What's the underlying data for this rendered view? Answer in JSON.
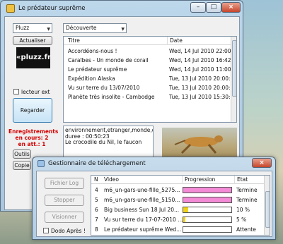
{
  "main": {
    "title": "Le prédateur suprême",
    "source_combo": "Pluzz",
    "category_combo": "Découverte",
    "refresh_label": "Actualiser",
    "logo_text": "«pluzz.fr",
    "ext_player_label": "lecteur ext",
    "watch_label": "Regarder",
    "recording_status": "Enregistrements",
    "recording_current": "en cours: 2",
    "recording_pending": "en att.: 1",
    "tools_label": "Outils",
    "copy_label": "Copie",
    "columns": [
      "Titre",
      "Date"
    ],
    "rows": [
      {
        "title": "Accordéons-nous !",
        "date": "Wed, 14 Jul 2010 22:00:..."
      },
      {
        "title": "Caraïbes - Un monde de corail",
        "date": "Wed, 14 Jul 2010 16:42:..."
      },
      {
        "title": "Le prédateur suprême",
        "date": "Wed, 14 Jul 2010 11:00:..."
      },
      {
        "title": "Expédition Alaska",
        "date": "Tue, 13 Jul 2010 20:00:..."
      },
      {
        "title": "Vu sur terre du 13/07/2010",
        "date": "Tue, 13 Jul 2010 20:00:..."
      },
      {
        "title": "Planète très insolite - Cambodge",
        "date": "Tue, 13 Jul 2010 15:30:..."
      }
    ],
    "info_tags": "environnement,etranger,monde,documentaire",
    "info_duration": "duree : 00:50:23",
    "info_text": "Le crocodile du Nil, le faucon"
  },
  "dm": {
    "title": "Gestionnaire de téléchargement",
    "file_log_label": "Fichier Log",
    "stop_label": "Stopper",
    "view_label": "Visionner",
    "shutdown_label": "Dodo Après !",
    "columns": [
      "N",
      "Video",
      "Progression",
      "Etat"
    ],
    "rows": [
      {
        "n": "4",
        "video": "m6_un-gars-une-fille_5275...",
        "progress": 1.0,
        "state": "Termine",
        "color": "#f38bd6"
      },
      {
        "n": "5",
        "video": "m6_un-gars-une-fille_5150...",
        "progress": 1.0,
        "state": "Termine",
        "color": "#f38bd6"
      },
      {
        "n": "6",
        "video": "Big business Sun 18 Jul 20...",
        "progress": 0.1,
        "state": "10 %",
        "color": "#f1d21a"
      },
      {
        "n": "7",
        "video": "Vu sur terre du 17-07-2010 ...",
        "progress": 0.05,
        "state": "5 %",
        "color": "#f1d21a"
      },
      {
        "n": "8",
        "video": "Le prédateur suprême Wed...",
        "progress": 0,
        "state": "Attente",
        "color": "#f1d21a"
      }
    ]
  },
  "colors": {
    "accent": "#d40000",
    "done": "#f38bd6",
    "progress": "#f1d21a"
  }
}
